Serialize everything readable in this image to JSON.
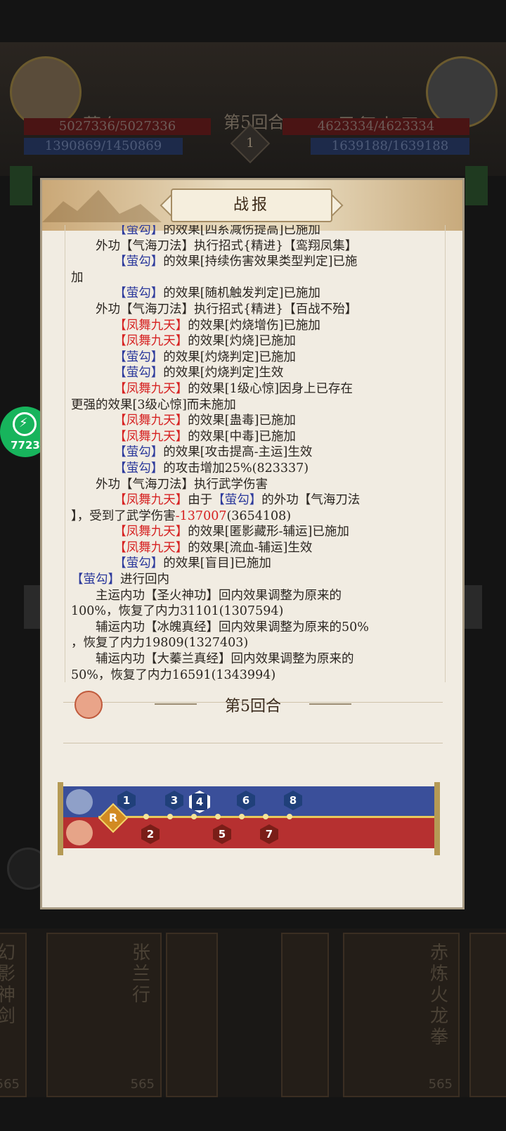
{
  "background": {
    "left_player_name": "萤勾",
    "right_player_name": "凤舞九天",
    "round_caption": "第5回合",
    "round_number": "1",
    "left_hp": "5027336/5027336",
    "left_mp": "1390869/1450869",
    "right_hp": "4623334/4623334",
    "right_mp": "1639188/1639188",
    "card_left_title": "幻影神剑",
    "card_mid_title": "张兰行",
    "card_right_title": "赤炼火龙拳",
    "card_cost": "565"
  },
  "badge": {
    "label": "7723"
  },
  "modal": {
    "title": "战报",
    "round_label": "第5回合",
    "log": [
      [
        {
          "t": "　　　　【萤勾】",
          "c": "blue"
        },
        {
          "t": "的效果[四系减伤提高]已施加"
        }
      ],
      [
        {
          "t": "　　外功【气海刀法】执行招式{精进}【鸾翔凤集】"
        }
      ],
      [
        {
          "t": "　　　　【萤勾】",
          "c": "blue"
        },
        {
          "t": "的效果[持续伤害效果类型判定]已施"
        }
      ],
      [
        {
          "t": "加"
        }
      ],
      [
        {
          "t": "　　　　【萤勾】",
          "c": "blue"
        },
        {
          "t": "的效果[随机触发判定]已施加"
        }
      ],
      [
        {
          "t": "　　外功【气海刀法】执行招式{精进}【百战不殆】"
        }
      ],
      [
        {
          "t": "　　　　【凤舞九天】",
          "c": "red"
        },
        {
          "t": "的效果[灼烧增伤]已施加"
        }
      ],
      [
        {
          "t": "　　　　【凤舞九天】",
          "c": "red"
        },
        {
          "t": "的效果[灼烧]已施加"
        }
      ],
      [
        {
          "t": "　　　　【萤勾】",
          "c": "blue"
        },
        {
          "t": "的效果[灼烧判定]已施加"
        }
      ],
      [
        {
          "t": "　　　　【萤勾】",
          "c": "blue"
        },
        {
          "t": "的效果[灼烧判定]生效"
        }
      ],
      [
        {
          "t": "　　　　【凤舞九天】",
          "c": "red"
        },
        {
          "t": "的效果[1级心惊]因身上已存在"
        }
      ],
      [
        {
          "t": "更强的效果[3级心惊]而未施加"
        }
      ],
      [
        {
          "t": "　　　　【凤舞九天】",
          "c": "red"
        },
        {
          "t": "的效果[蛊毒]已施加"
        }
      ],
      [
        {
          "t": "　　　　【凤舞九天】",
          "c": "red"
        },
        {
          "t": "的效果[中毒]已施加"
        }
      ],
      [
        {
          "t": "　　　　【萤勾】",
          "c": "blue"
        },
        {
          "t": "的效果[攻击提高-主运]生效"
        }
      ],
      [
        {
          "t": "　　　　【萤勾】",
          "c": "blue"
        },
        {
          "t": "的攻击增加25%(823337)"
        }
      ],
      [
        {
          "t": "　　外功【气海刀法】执行武学伤害"
        }
      ],
      [
        {
          "t": "　　　　【凤舞九天】",
          "c": "red"
        },
        {
          "t": "由于"
        },
        {
          "t": "【萤勾】",
          "c": "blue"
        },
        {
          "t": "的外功【气海刀法"
        }
      ],
      [
        {
          "t": "】，受到了武学伤害"
        },
        {
          "t": "-137007",
          "c": "red"
        },
        {
          "t": "(3654108)"
        }
      ],
      [
        {
          "t": "　　　　【凤舞九天】",
          "c": "red"
        },
        {
          "t": "的效果[匿影藏形-辅运]已施加"
        }
      ],
      [
        {
          "t": "　　　　【凤舞九天】",
          "c": "red"
        },
        {
          "t": "的效果[流血-辅运]生效"
        }
      ],
      [
        {
          "t": "　　　　【萤勾】",
          "c": "blue"
        },
        {
          "t": "的效果[盲目]已施加"
        }
      ],
      [
        {
          "t": "【萤勾】",
          "c": "blue"
        },
        {
          "t": "进行回内"
        }
      ],
      [
        {
          "t": "　　主运内功【圣火神功】回内效果调整为原来的"
        }
      ],
      [
        {
          "t": "100%，恢复了内力31101(1307594)"
        }
      ],
      [
        {
          "t": "　　辅运内功【冰魄真经】回内效果调整为原来的50%"
        }
      ],
      [
        {
          "t": "，恢复了内力19809(1327403)"
        }
      ],
      [
        {
          "t": "　　辅运内功【大蓁兰真经】回内效果调整为原来的"
        }
      ],
      [
        {
          "t": "50%，恢复了内力16591(1343994)"
        }
      ]
    ],
    "timeline": {
      "r_label": "R",
      "blue_markers": [
        "1",
        "3",
        "4",
        "6",
        "8"
      ],
      "red_markers": [
        "2",
        "5",
        "7"
      ],
      "current": "4"
    }
  }
}
